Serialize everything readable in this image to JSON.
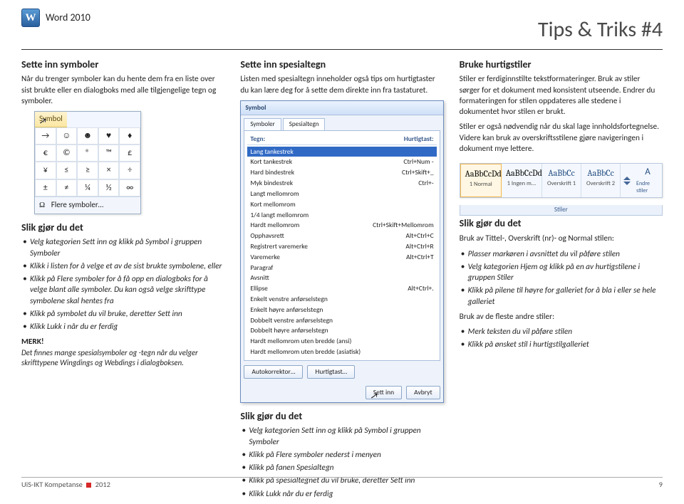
{
  "header": {
    "product": "Word 2010",
    "page_title": "Tips & Triks #4"
  },
  "col1": {
    "h": "Sette inn symboler",
    "intro": "Når du trenger symboler kan du hente dem fra en liste over sist brukte eller en dialogboks med alle tilgjengelige tegn og symboler.",
    "dropdown": {
      "btn": "Symbol",
      "cells": [
        "→",
        "☺",
        "☻",
        "♥",
        "♦",
        "€",
        "©",
        "®",
        "™",
        "£",
        "¥",
        "≤",
        "≥",
        "×",
        "÷",
        "±",
        "≠",
        "¼",
        "½",
        "∞"
      ],
      "more": "Flere symboler…",
      "omega": "Ω"
    },
    "howto_h": "Slik gjør du det",
    "steps": [
      "Velg kategorien Sett inn og klikk på Symbol i gruppen Symboler",
      "Klikk i listen for å velge et av de sist brukte symbolene, eller",
      "Klikk på Flere symboler for å få opp en dialogboks for å velge blant alle symboler. Du kan også velge skrifttype symbolene skal hentes fra",
      "Klikk på symbolet du vil bruke, deretter Sett inn",
      "Klikk Lukk i når du er ferdig"
    ],
    "note_h": "MERK!",
    "note": "Det finnes mange spesialsymboler og -tegn når du velger skrifttypene Wingdings og Webdings i dialogboksen."
  },
  "col2": {
    "h": "Sette inn spesialtegn",
    "intro": "Listen med spesialtegn inneholder også tips om hurtigtaster du kan lære deg for å sette dem direkte inn fra tastaturet.",
    "dialog": {
      "title": "Symbol",
      "tab1": "Symboler",
      "tab2": "Spesialtegn",
      "col_a": "Tegn:",
      "col_b": "Hurtigtast:",
      "rows": [
        [
          "—",
          "Lang tankestrek",
          ""
        ],
        [
          "–",
          "Kort tankestrek",
          "Ctrl+Num -"
        ],
        [
          "-",
          "Hard bindestrek",
          "Ctrl+Skift+_"
        ],
        [
          "­",
          "Myk bindestrek",
          "Ctrl+-"
        ],
        [
          " ",
          "Langt mellomrom",
          ""
        ],
        [
          " ",
          "Kort mellomrom",
          ""
        ],
        [
          " ",
          "1/4 langt mellomrom",
          ""
        ],
        [
          " ",
          "Hardt mellomrom",
          "Ctrl+Skift+Mellomrom"
        ],
        [
          "©",
          "Opphavsrett",
          "Alt+Ctrl+C"
        ],
        [
          "®",
          "Registrert varemerke",
          "Alt+Ctrl+R"
        ],
        [
          "™",
          "Varemerke",
          "Alt+Ctrl+T"
        ],
        [
          "¶",
          "Paragraf",
          ""
        ],
        [
          "§",
          "Avsnitt",
          ""
        ],
        [
          "…",
          "Ellipse",
          "Alt+Ctrl+."
        ],
        [
          "'",
          "Enkelt venstre anførselstegn",
          ""
        ],
        [
          "'",
          "Enkelt høyre anførselstegn",
          ""
        ],
        [
          "\"",
          "Dobbelt venstre anførselstegn",
          ""
        ],
        [
          "\"",
          "Dobbelt høyre anførselstegn",
          ""
        ],
        [
          " ",
          "Hardt mellomrom uten bredde (ansi)",
          ""
        ],
        [
          " ",
          "Hardt mellomrom uten bredde (asiatisk)",
          ""
        ]
      ],
      "btn_auto": "Autokorrektor…",
      "btn_hk": "Hurtigtast…",
      "btn_ins": "Sett inn",
      "btn_cancel": "Avbryt"
    },
    "howto_h": "Slik gjør du det",
    "steps": [
      "Velg kategorien Sett inn og klikk på Symbol i gruppen Symboler",
      "Klikk på Flere symboler nederst i menyen",
      "Klikk på fanen Spesialtegn",
      "Klikk på spesialtegnet du vil bruke, deretter Sett inn",
      "Klikk Lukk når du er ferdig"
    ]
  },
  "col3": {
    "h": "Bruke hurtigstiler",
    "p1": "Stiler er ferdiginnstilte tekstformateringer. Bruk av stiler sørger for et dokument med konsistent utseende. Endrer du formateringen for stilen oppdateres alle stedene i dokumentet hvor stilen er brukt.",
    "p2": "Stiler er også nødvendig når du skal lage innholdsfortegnelse. Videre kan bruk av overskriftsstilene gjøre navigeringen i dokument mye lettere.",
    "ribbon": {
      "items": [
        {
          "preview": "AaBbCcDd",
          "label": "1 Normal"
        },
        {
          "preview": "AaBbCcDd",
          "label": "1 Ingen m..."
        },
        {
          "preview": "AaBbCc",
          "label": "Overskrift 1"
        },
        {
          "preview": "AaBbCc",
          "label": "Overskrift 2"
        }
      ],
      "change": "Endre stiler",
      "group": "Stiler"
    },
    "howto_h": "Slik gjør du det",
    "lead": "Bruk av Tittel-, Overskrift (nr)- og Normal stilen:",
    "stepsA": [
      "Plasser markøren i avsnittet du vil påføre stilen",
      "Velg kategorien Hjem og klikk på en av hurtigstilene i gruppen Stiler",
      "Klikk på pilene til høyre for galleriet for å bla i eller se hele galleriet"
    ],
    "lead2": "Bruk av de fleste andre stiler:",
    "stepsB": [
      "Merk teksten du vil påføre stilen",
      "Klikk på ønsket stil i hurtigstilgalleriet"
    ]
  },
  "footer": {
    "left": "UiS-IKT Kompetanse",
    "year": "2012",
    "page": "9"
  }
}
